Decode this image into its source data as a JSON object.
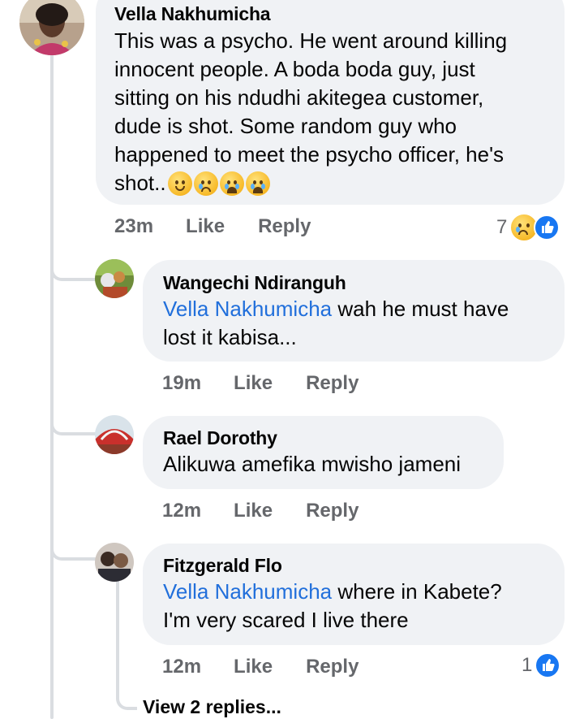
{
  "comments": [
    {
      "author": "Vella Nakhumicha",
      "text": "This was a psycho. He went around killing innocent people. A boda boda guy, just sitting on his ndudhi akitegea customer, dude is shot. Some random guy who happened to meet the psycho officer, he's shot..",
      "text_lines": [
        "This was a psycho. He went around killing",
        "innocent people. A boda boda guy, just",
        "sitting on his ndudhi akitegea customer,",
        "dude is shot. Some random guy who",
        "happened to meet the psycho officer, he's",
        "shot.."
      ],
      "emojis": [
        "worried-face",
        "sad-face",
        "crying-face",
        "crying-face"
      ],
      "time": "23m",
      "like_label": "Like",
      "reply_label": "Reply",
      "reaction_count": "7",
      "reaction_icons": [
        "sad-reaction",
        "like-reaction"
      ]
    }
  ],
  "replies": [
    {
      "author": "Wangechi Ndiranguh",
      "mention": "Vella Nakhumicha",
      "text_line1": " wah he must have",
      "text_line2": "lost it kabisa...",
      "time": "19m",
      "like_label": "Like",
      "reply_label": "Reply"
    },
    {
      "author": "Rael Dorothy",
      "text": "Alikuwa amefika mwisho jameni",
      "time": "12m",
      "like_label": "Like",
      "reply_label": "Reply"
    },
    {
      "author": "Fitzgerald Flo",
      "mention": "Vella Nakhumicha",
      "text_line1": " where in Kabete?",
      "text_line2": "I'm very scared I live there",
      "time": "12m",
      "like_label": "Like",
      "reply_label": "Reply",
      "reaction_count": "1",
      "reaction_icons": [
        "like-reaction"
      ]
    }
  ],
  "view_replies": "View 2 replies..."
}
